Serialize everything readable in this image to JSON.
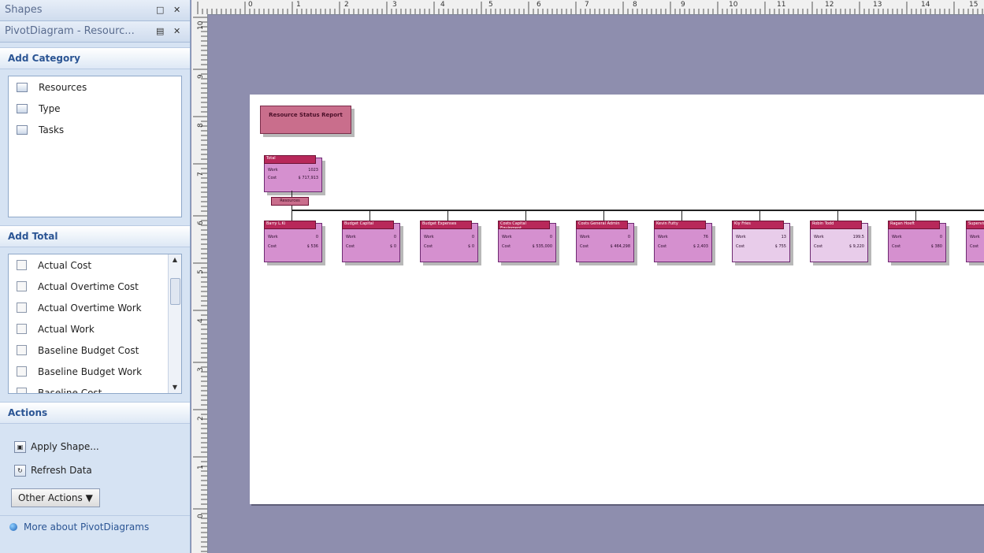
{
  "pane": {
    "shapes_title": "Shapes",
    "pivot_title": "PivotDiagram - Resourc...",
    "add_category": {
      "title": "Add Category",
      "items": [
        "Resources",
        "Type",
        "Tasks"
      ]
    },
    "add_total": {
      "title": "Add Total",
      "items": [
        "Actual Cost",
        "Actual Overtime Cost",
        "Actual Overtime Work",
        "Actual Work",
        "Baseline Budget Cost",
        "Baseline Budget Work",
        "Baseline Cost"
      ]
    },
    "actions": {
      "title": "Actions",
      "apply_shape": "Apply Shape...",
      "refresh_data": "Refresh Data",
      "other_actions": "Other Actions",
      "more_about": "More about PivotDiagrams"
    }
  },
  "rulers": {
    "horizontal": [
      "0",
      "1",
      "2",
      "3",
      "4",
      "5",
      "6",
      "7",
      "8",
      "9",
      "10",
      "11",
      "12",
      "13",
      "14",
      "15"
    ],
    "vertical": [
      "10",
      "9",
      "8",
      "7",
      "6",
      "5",
      "4",
      "3",
      "2",
      "1",
      "0"
    ]
  },
  "diagram": {
    "title": "Resource Status Report",
    "total_node": {
      "header": "Total",
      "work_label": "Work",
      "work": "1023",
      "cost_label": "Cost",
      "cost": "$ 717,913"
    },
    "tag": "Resources",
    "nodes": [
      {
        "header": "Barry L.Ki",
        "work": "0",
        "cost": "$ 536",
        "tone": "mid"
      },
      {
        "header": "Budget Capital",
        "work": "0",
        "cost": "$ 0",
        "tone": "mid"
      },
      {
        "header": "Budget Expenses",
        "work": "0",
        "cost": "$ 0",
        "tone": "mid"
      },
      {
        "header": "Costs Capital Equipment",
        "work": "0",
        "cost": "$ 535,000",
        "tone": "mid"
      },
      {
        "header": "Costs General Admin",
        "work": "0",
        "cost": "$ 464,298",
        "tone": "mid"
      },
      {
        "header": "Kevin Futty",
        "work": "76",
        "cost": "$ 2,403",
        "tone": "mid"
      },
      {
        "header": "Kiy Fries",
        "work": "13",
        "cost": "$ 755",
        "tone": "light"
      },
      {
        "header": "Robin Todd",
        "work": "199.5",
        "cost": "$ 9,220",
        "tone": "light"
      },
      {
        "header": "Ragan Hoeft",
        "work": "0",
        "cost": "$ 380",
        "tone": "mid"
      },
      {
        "header": "Supervisor",
        "work": "",
        "cost": "",
        "tone": "mid"
      }
    ],
    "row_labels": {
      "work": "Work",
      "cost": "Cost"
    }
  }
}
